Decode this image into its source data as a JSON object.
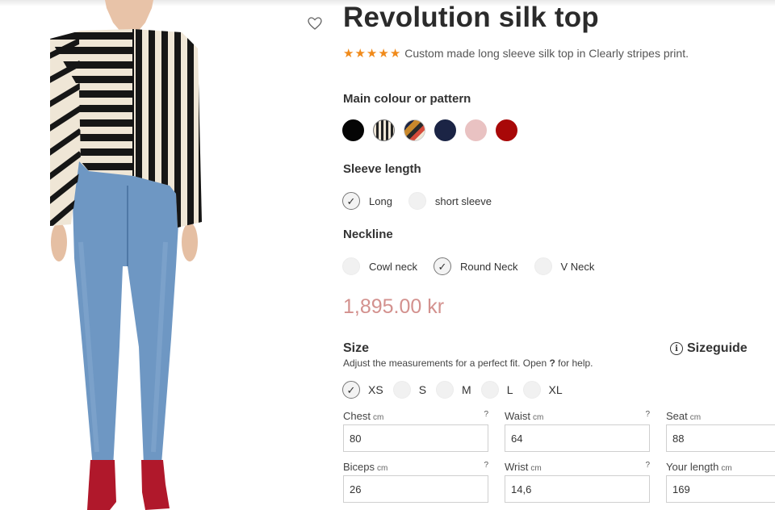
{
  "product": {
    "title": "Revolution silk top",
    "rating_stars": 5,
    "subtitle": "Custom made long sleeve silk top in Clearly stripes print.",
    "price": "1,895.00 kr"
  },
  "colour": {
    "label": "Main colour or pattern",
    "swatches": [
      {
        "name": "black",
        "color": "#050505"
      },
      {
        "name": "stripes",
        "color": "#2a2a2a"
      },
      {
        "name": "pattern",
        "color": "#c9882b"
      },
      {
        "name": "navy",
        "color": "#1b2445"
      },
      {
        "name": "pink",
        "color": "#e9c2c2"
      },
      {
        "name": "red",
        "color": "#a80808"
      }
    ]
  },
  "sleeve": {
    "label": "Sleeve length",
    "options": [
      "Long",
      "short sleeve"
    ],
    "selected": "Long"
  },
  "neckline": {
    "label": "Neckline",
    "options": [
      "Cowl neck",
      "Round Neck",
      "V Neck"
    ],
    "selected": "Round Neck"
  },
  "size": {
    "title": "Size",
    "help_prefix": "Adjust the measurements for a perfect fit. Open ",
    "help_q": "?",
    "help_suffix": " for help.",
    "guide_label": "Sizeguide",
    "info_glyph": "i",
    "options": [
      "XS",
      "S",
      "M",
      "L",
      "XL"
    ],
    "selected": "XS"
  },
  "measurements": {
    "unit": "cm",
    "help": "?",
    "fields": [
      {
        "label": "Chest",
        "value": "80",
        "has_help": true
      },
      {
        "label": "Waist",
        "value": "64",
        "has_help": true
      },
      {
        "label": "Seat",
        "value": "88",
        "has_help": false
      },
      {
        "label": "Biceps",
        "value": "26",
        "has_help": true
      },
      {
        "label": "Wrist",
        "value": "14,6",
        "has_help": true
      },
      {
        "label": "Your length",
        "value": "169",
        "has_help": false
      }
    ]
  },
  "check_glyph": "✓",
  "star_glyph": "★"
}
